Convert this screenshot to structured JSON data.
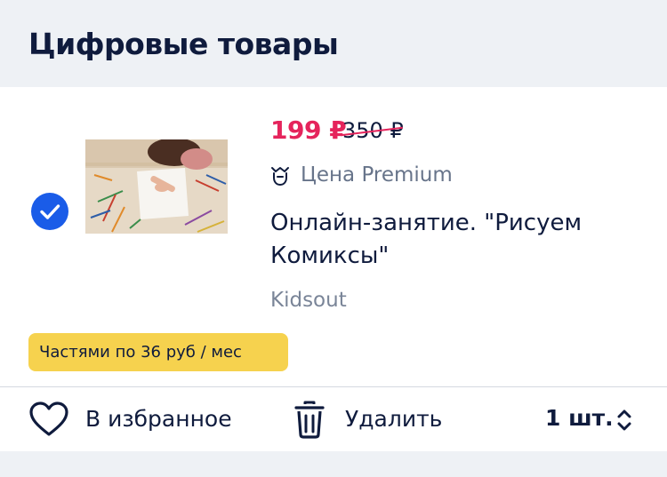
{
  "section": {
    "title": "Цифровые товары"
  },
  "item": {
    "selected": true,
    "thumbnail_icon": "child-drawing-photo",
    "price_current": "199 ₽",
    "price_old": "350 ₽",
    "premium_label": "Цена Premium",
    "premium_icon": "premium-crown-icon",
    "title": "Онлайн-занятие. \"Рисуем Комиксы\"",
    "seller": "Kidsout",
    "installment": "Частями по 36 руб / мес"
  },
  "actions": {
    "favorite_label": "В избранное",
    "delete_label": "Удалить",
    "quantity_label": "1 шт."
  },
  "colors": {
    "accent_blue": "#1a5ce8",
    "price_red": "#e5245c",
    "badge_yellow": "#f6d24e",
    "text_dark": "#0f1b3d"
  }
}
